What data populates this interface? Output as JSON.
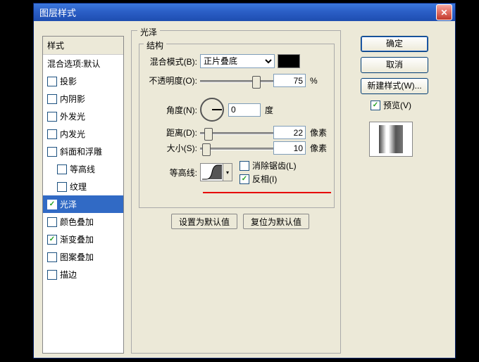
{
  "title": "图层样式",
  "styles_header": "样式",
  "styles": {
    "blend_default": "混合选项:默认",
    "drop_shadow": "投影",
    "inner_shadow": "内阴影",
    "outer_glow": "外发光",
    "inner_glow": "内发光",
    "bevel": "斜面和浮雕",
    "contour_sub": "等高线",
    "texture_sub": "纹理",
    "satin": "光泽",
    "color_overlay": "颜色叠加",
    "grad_overlay": "渐变叠加",
    "pattern_overlay": "图案叠加",
    "stroke": "描边"
  },
  "checked": {
    "satin": "✓",
    "grad": "✓"
  },
  "section": {
    "title": "光泽",
    "structure": "结构"
  },
  "labels": {
    "blend": "混合模式(B):",
    "opacity": "不透明度(O):",
    "angle": "角度(N):",
    "distance": "距离(D):",
    "size": "大小(S):",
    "contour": "等高线:",
    "deg": "度",
    "px": "像素",
    "pct": "%"
  },
  "values": {
    "blend_mode": "正片叠底",
    "opacity": "75",
    "angle": "0",
    "distance": "22",
    "size": "10"
  },
  "checks": {
    "antialias": "消除锯齿(L)",
    "invert": "反相(I)",
    "invert_on": "✓"
  },
  "btns": {
    "set_default": "设置为默认值",
    "reset_default": "复位为默认值"
  },
  "right": {
    "ok": "确定",
    "cancel": "取消",
    "new_style": "新建样式(W)...",
    "preview": "预览(V)",
    "preview_on": "✓"
  }
}
